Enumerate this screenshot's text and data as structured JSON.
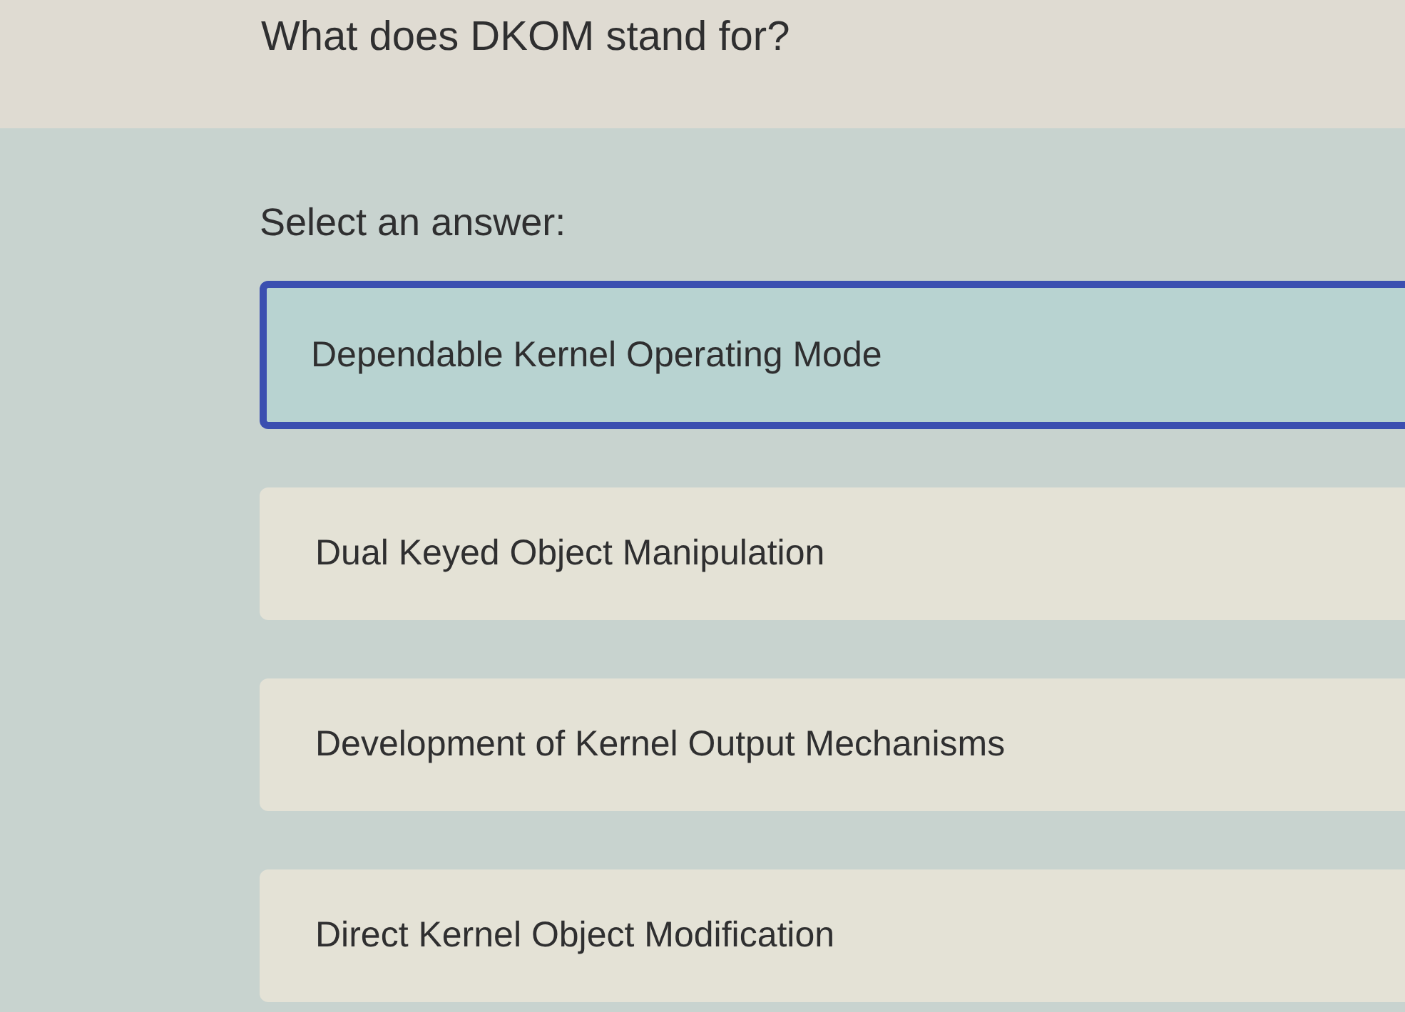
{
  "question": "What does DKOM stand for?",
  "prompt": "Select an answer:",
  "answers": [
    {
      "label": "Dependable Kernel Operating Mode",
      "selected": true
    },
    {
      "label": "Dual Keyed Object Manipulation",
      "selected": false
    },
    {
      "label": "Development of Kernel Output Mechanisms",
      "selected": false
    },
    {
      "label": "Direct Kernel Object Modification",
      "selected": false
    }
  ]
}
